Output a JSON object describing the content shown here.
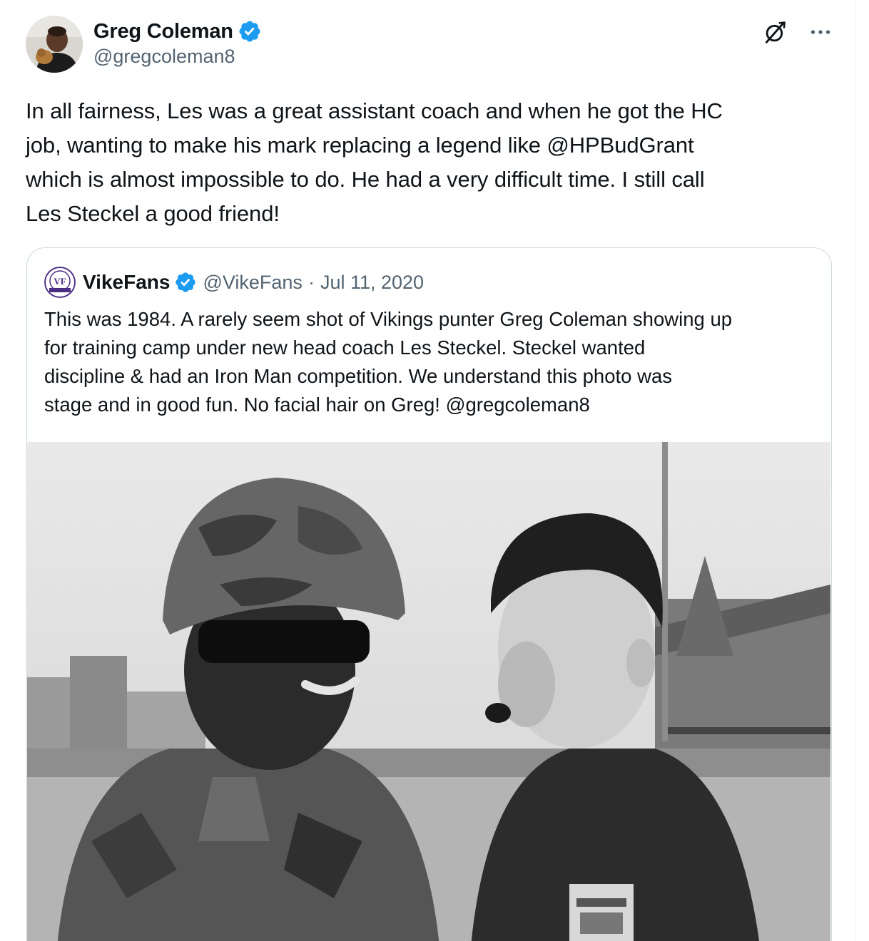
{
  "author": {
    "display_name": "Greg Coleman",
    "handle": "@gregcoleman8",
    "avatar_icon": "avatar-photo",
    "verified_icon": "verified-badge-icon",
    "verified_color": "#1d9bf0"
  },
  "actions": {
    "grok_icon": "grok-icon",
    "more_icon": "more-options-icon"
  },
  "tweet": {
    "text": "In all fairness, Les was a great assistant coach and when he got the HC\njob, wanting to make his mark replacing a legend like @HPBudGrant\nwhich is almost impossible to do. He had a very difficult time. I still call\nLes Steckel a good friend!"
  },
  "quoted": {
    "display_name": "VikeFans",
    "handle": "@VikeFans",
    "separator": "·",
    "date": "Jul 11, 2020",
    "text": "This was 1984.  A rarely seem shot of Vikings punter Greg Coleman showing up\nfor training camp under new head coach Les Steckel.  Steckel wanted\ndiscipline & had an Iron Man competition.  We understand this photo was\nstage and in good fun.  No facial hair on Greg! @gregcoleman8",
    "avatar_icon": "vikefans-logo",
    "photo": "black-and-white-photo-helmeted-man-and-coach"
  }
}
